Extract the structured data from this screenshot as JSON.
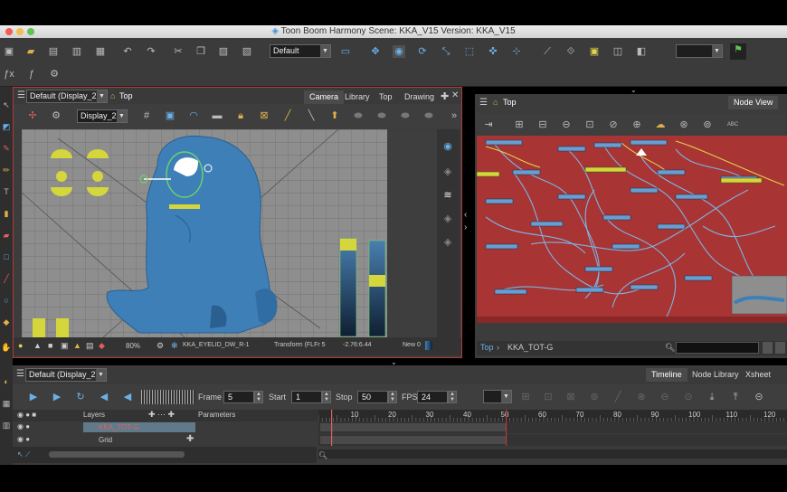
{
  "window": {
    "title": "Toon Boom Harmony Scene: KKA_V15 Version: KKA_V15"
  },
  "toolbar": {
    "workspace_combo": "Default"
  },
  "camera_view": {
    "view_combo": "Default (Display_2)",
    "breadcrumb": "Top",
    "tabs": [
      "Camera",
      "Library",
      "Top",
      "Drawing"
    ],
    "display_combo": "Display_2",
    "status": {
      "zoom": "80%",
      "selected_node": "KKA_EYELID_DW_R-1",
      "transform": "Transform (FLFr 5",
      "coords": "-2.76:6.44",
      "mode": "New 0"
    }
  },
  "node_view": {
    "breadcrumb": "Top",
    "tab": "Node View",
    "footer_path": "Top",
    "footer_node": "KKA_TOT-G"
  },
  "timeline": {
    "view_combo": "Default (Display_2)",
    "tabs": [
      "Timeline",
      "Node Library",
      "Xsheet"
    ],
    "frame_label": "Frame",
    "frame_value": "5",
    "start_label": "Start",
    "start_value": "1",
    "stop_label": "Stop",
    "stop_value": "50",
    "fps_label": "FPS",
    "fps_value": "24",
    "layers_header": "Layers",
    "params_header": "Parameters",
    "layers": [
      "KKA_TOT-G",
      "Grid"
    ],
    "ruler": [
      "10",
      "20",
      "30",
      "40",
      "50",
      "60",
      "70",
      "80",
      "90",
      "100",
      "110",
      "120"
    ]
  },
  "colors": {
    "accent_red": "#a83434",
    "character_blue": "#3e7fb8",
    "highlight_yellow": "#d4d63c"
  }
}
